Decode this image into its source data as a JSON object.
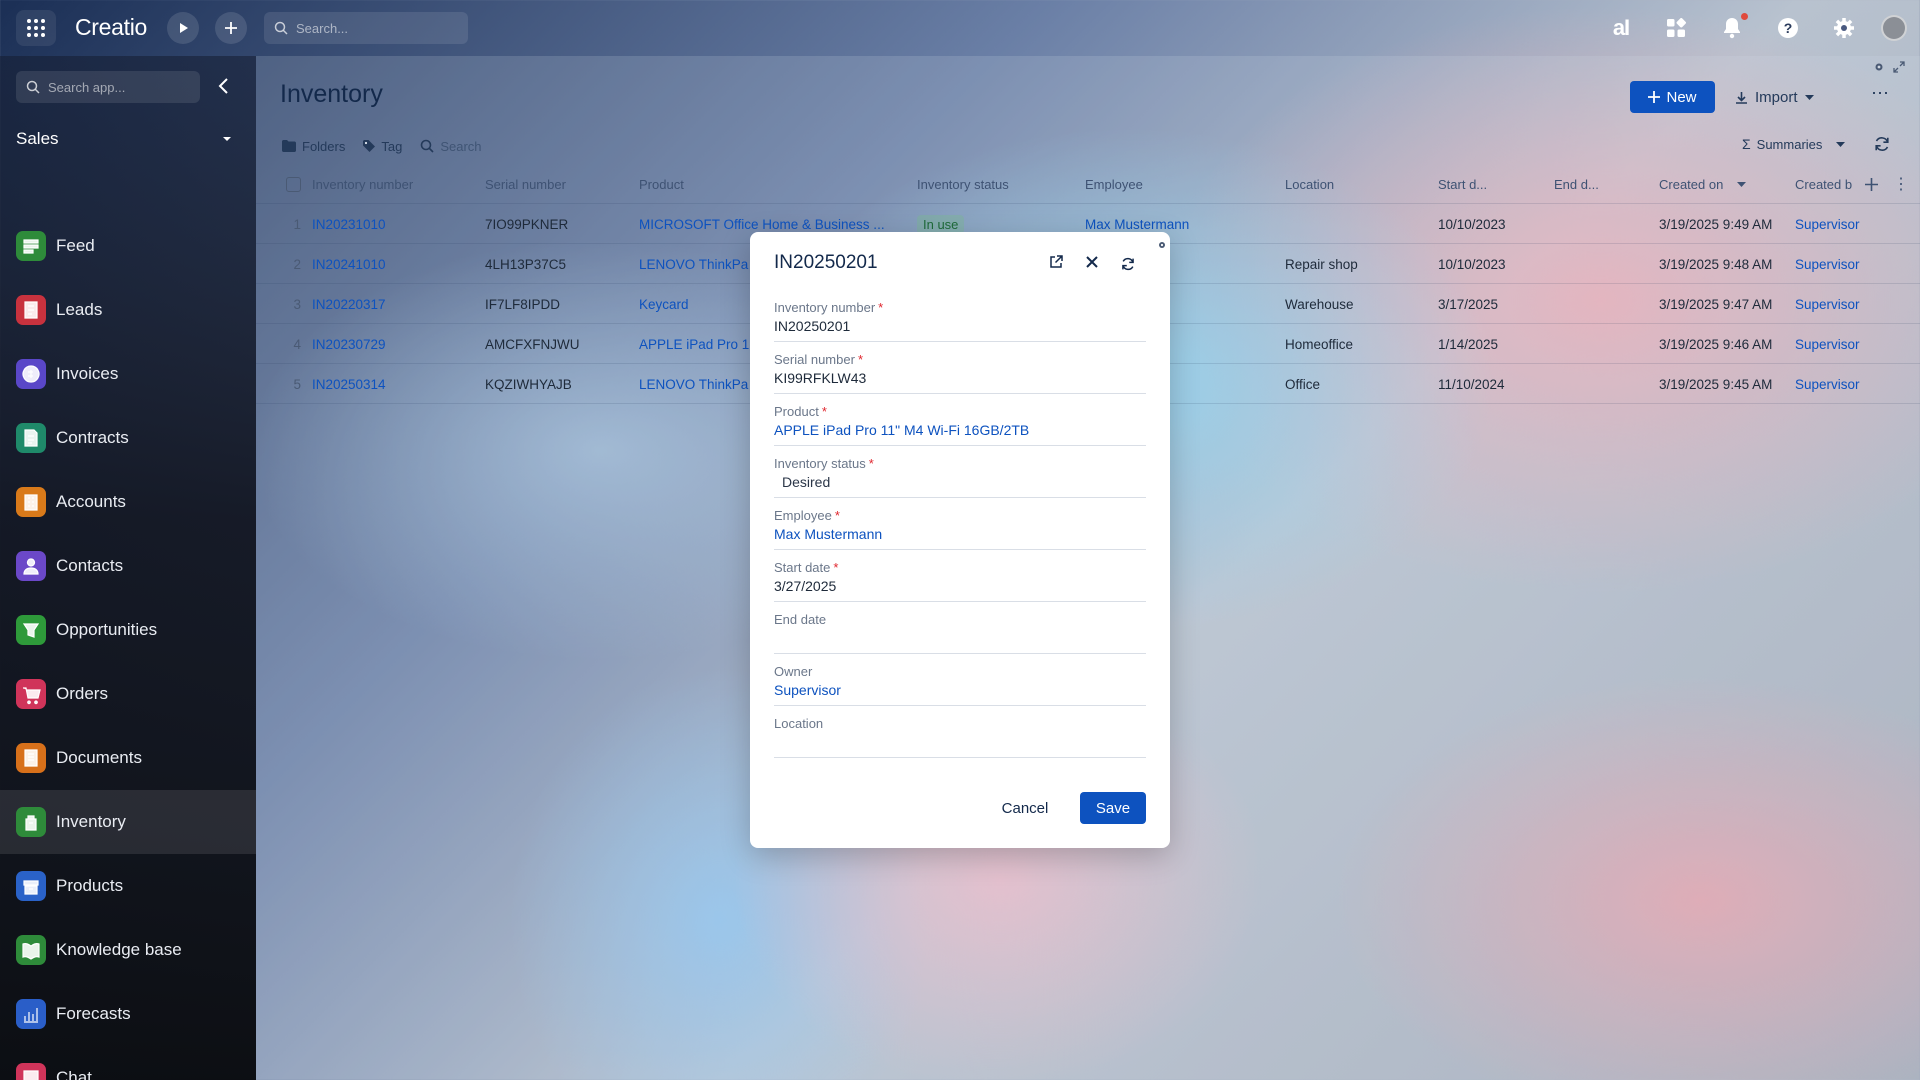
{
  "app": {
    "brand": "Creatio",
    "search_placeholder": "Search..."
  },
  "sidebar": {
    "search_placeholder": "Search app...",
    "workspace": "Sales",
    "items": [
      {
        "label": "Feed",
        "icon": "feed-icon",
        "color": "#2e8b3a"
      },
      {
        "label": "Leads",
        "icon": "leads-icon",
        "color": "#c8323e"
      },
      {
        "label": "Invoices",
        "icon": "invoices-icon",
        "color": "#5a47c8"
      },
      {
        "label": "Contracts",
        "icon": "contracts-icon",
        "color": "#1f8a6a"
      },
      {
        "label": "Accounts",
        "icon": "accounts-icon",
        "color": "#d97a1a"
      },
      {
        "label": "Contacts",
        "icon": "contacts-icon",
        "color": "#6b48c8"
      },
      {
        "label": "Opportunities",
        "icon": "opportunities-icon",
        "color": "#2e9a3a"
      },
      {
        "label": "Orders",
        "icon": "orders-icon",
        "color": "#d0345a"
      },
      {
        "label": "Documents",
        "icon": "documents-icon",
        "color": "#d7701a"
      },
      {
        "label": "Inventory",
        "icon": "inventory-icon",
        "color": "#2e8b3a",
        "active": true
      },
      {
        "label": "Products",
        "icon": "products-icon",
        "color": "#2a62c8"
      },
      {
        "label": "Knowledge base",
        "icon": "knowledge-base-icon",
        "color": "#2e8b3a"
      },
      {
        "label": "Forecasts",
        "icon": "forecasts-icon",
        "color": "#2a5ec8"
      },
      {
        "label": "Chat",
        "icon": "chat-icon",
        "color": "#d0345a"
      }
    ]
  },
  "page": {
    "title": "Inventory",
    "new_label": "New",
    "import_label": "Import",
    "folders_label": "Folders",
    "tag_label": "Tag",
    "search_placeholder": "Search",
    "summaries_label": "Summaries"
  },
  "table": {
    "columns": [
      "Inventory number",
      "Serial number",
      "Product",
      "Inventory status",
      "Employee",
      "Location",
      "Start d...",
      "End d...",
      "Created on",
      "Created b"
    ],
    "rows": [
      {
        "n": "1",
        "inv": "IN20231010",
        "serial": "7IO99PKNER",
        "product": "MICROSOFT Office Home & Business ...",
        "status": "In use",
        "employee": "Max Mustermann",
        "location": "",
        "start": "10/10/2023",
        "end": "",
        "created": "3/19/2025 9:49 AM",
        "by": "Supervisor"
      },
      {
        "n": "2",
        "inv": "IN20241010",
        "serial": "4LH13P37C5",
        "product": "LENOVO ThinkPa",
        "status": "",
        "employee": "nann",
        "location": "Repair shop",
        "start": "10/10/2023",
        "end": "",
        "created": "3/19/2025 9:48 AM",
        "by": "Supervisor"
      },
      {
        "n": "3",
        "inv": "IN20220317",
        "serial": "IF7LF8IPDD",
        "product": "Keycard",
        "status": "",
        "employee": "nann",
        "location": "Warehouse",
        "start": "3/17/2025",
        "end": "",
        "created": "3/19/2025 9:47 AM",
        "by": "Supervisor"
      },
      {
        "n": "4",
        "inv": "IN20230729",
        "serial": "AMCFXFNJWU",
        "product": "APPLE iPad Pro 1",
        "status": "",
        "employee": "",
        "location": "Homeoffice",
        "start": "1/14/2025",
        "end": "",
        "created": "3/19/2025 9:46 AM",
        "by": "Supervisor"
      },
      {
        "n": "5",
        "inv": "IN20250314",
        "serial": "KQZIWHYAJB",
        "product": "LENOVO ThinkPa",
        "status": "",
        "employee": "",
        "location": "Office",
        "start": "11/10/2024",
        "end": "",
        "created": "3/19/2025 9:45 AM",
        "by": "Supervisor"
      }
    ]
  },
  "modal": {
    "title": "IN20250201",
    "fields": [
      {
        "label": "Inventory number",
        "required": true,
        "value": "IN20250201",
        "kind": "text"
      },
      {
        "label": "Serial number",
        "required": true,
        "value": "KI99RFKLW43",
        "kind": "text"
      },
      {
        "label": "Product",
        "required": true,
        "value": "APPLE iPad Pro 11\" M4 Wi-Fi 16GB/2TB",
        "kind": "link"
      },
      {
        "label": "Inventory status",
        "required": true,
        "value": "Desired",
        "kind": "chip"
      },
      {
        "label": "Employee",
        "required": true,
        "value": "Max Mustermann",
        "kind": "link"
      },
      {
        "label": "Start date",
        "required": true,
        "value": "3/27/2025",
        "kind": "text"
      },
      {
        "label": "End date",
        "required": false,
        "value": "",
        "kind": "text"
      },
      {
        "label": "Owner",
        "required": false,
        "value": "Supervisor",
        "kind": "link"
      },
      {
        "label": "Location",
        "required": false,
        "value": "",
        "kind": "text"
      }
    ],
    "cancel_label": "Cancel",
    "save_label": "Save"
  }
}
